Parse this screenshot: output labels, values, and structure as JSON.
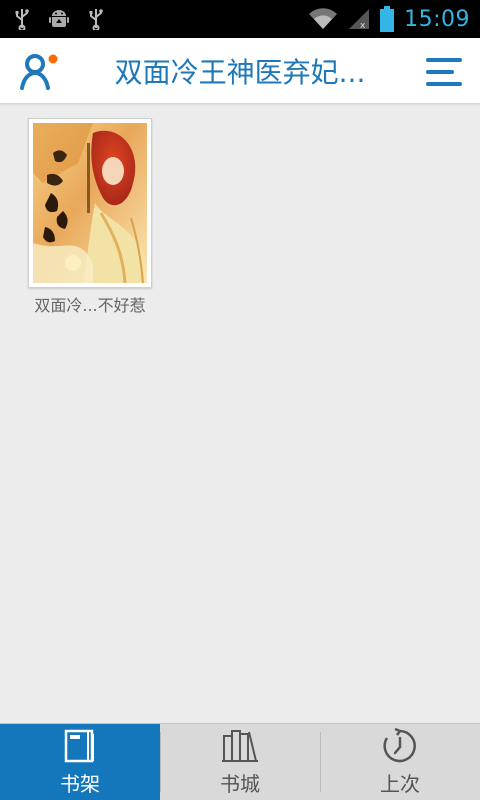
{
  "status_bar": {
    "time": "15:09",
    "icons": [
      "usb-icon",
      "android-debug-icon",
      "usb-icon",
      "wifi-icon",
      "signal-icon",
      "battery-icon"
    ],
    "accent_color": "#33b5e5"
  },
  "app_bar": {
    "title": "双面冷王神医弃妃...",
    "left_icon": "profile-icon",
    "right_icon": "menu-icon",
    "accent_color": "#1e78b9",
    "badge_color": "#ff6a00"
  },
  "shelf": {
    "books": [
      {
        "title": "双面冷...不好惹",
        "cover_icon": "book-cover-image"
      }
    ]
  },
  "bottom_nav": {
    "active_color": "#1476bb",
    "tabs": [
      {
        "label": "书架",
        "icon": "bookshelf-icon",
        "active": true
      },
      {
        "label": "书城",
        "icon": "bookstore-icon",
        "active": false
      },
      {
        "label": "上次",
        "icon": "history-icon",
        "active": false
      }
    ]
  }
}
